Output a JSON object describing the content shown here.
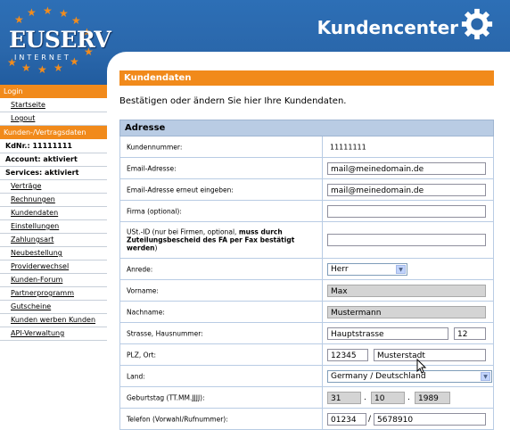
{
  "brand": {
    "logo_main": "EUSERV",
    "logo_sub": "INTERNET",
    "title": "Kundencenter"
  },
  "sidebar": {
    "login_header": "Login",
    "login_items": [
      {
        "label": "Startseite"
      },
      {
        "label": "Logout"
      }
    ],
    "account_header": "Kunden-/Vertragsdaten",
    "info": [
      {
        "label": "KdNr.: 11111111"
      },
      {
        "label": "Account: aktiviert"
      },
      {
        "label": "Services: aktiviert"
      }
    ],
    "items": [
      {
        "label": "Verträge"
      },
      {
        "label": "Rechnungen"
      },
      {
        "label": "Kundendaten"
      },
      {
        "label": "Einstellungen"
      },
      {
        "label": "Zahlungsart"
      },
      {
        "label": "Neubestellung"
      },
      {
        "label": "Providerwechsel"
      },
      {
        "label": "Kunden-Forum"
      },
      {
        "label": "Partnerprogramm"
      },
      {
        "label": "Gutscheine"
      },
      {
        "label": "Kunden werben Kunden"
      },
      {
        "label": "API-Verwaltung"
      }
    ]
  },
  "main": {
    "title": "Kundendaten",
    "intro": "Bestätigen oder ändern Sie hier Ihre Kundendaten.",
    "section": "Adresse",
    "fields": {
      "kundennummer": {
        "label": "Kundennummer:",
        "value": "11111111"
      },
      "email": {
        "label": "Email-Adresse:",
        "value": "mail@meinedomain.de"
      },
      "email2": {
        "label": "Email-Adresse erneut eingeben:",
        "value": "mail@meinedomain.de"
      },
      "firma": {
        "label": "Firma (optional):",
        "value": ""
      },
      "ustid": {
        "label_normal": "USt.-ID (nur bei Firmen, optional, ",
        "label_bold": "muss durch Zuteilungsbescheid des FA per Fax bestätigt werden",
        "label_end": ")",
        "value": ""
      },
      "anrede": {
        "label": "Anrede:",
        "value": "Herr"
      },
      "vorname": {
        "label": "Vorname:",
        "value": "Max"
      },
      "nachname": {
        "label": "Nachname:",
        "value": "Mustermann"
      },
      "strasse": {
        "label": "Strasse, Hausnummer:",
        "street": "Hauptstrasse",
        "number": "12"
      },
      "plz_ort": {
        "label": "PLZ, Ort:",
        "plz": "12345",
        "ort": "Musterstadt"
      },
      "land": {
        "label": "Land:",
        "value": "Germany / Deutschland"
      },
      "geburtstag": {
        "label": "Geburtstag (TT.MM.JJJJ):",
        "tag": "31",
        "monat": "10",
        "jahr": "1989",
        "sep": "."
      },
      "telefon": {
        "label": "Telefon (Vorwahl/Rufnummer):",
        "vorwahl": "01234",
        "sep": "/",
        "nummer": "5678910"
      }
    }
  },
  "colors": {
    "accent": "#f18a1b",
    "header_blue": "#2a67ab",
    "section_blue": "#b9cce4"
  }
}
